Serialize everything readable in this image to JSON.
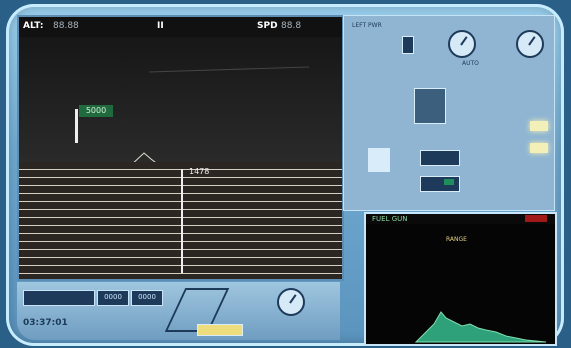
{
  "header": {
    "alt_label": "ALT:",
    "alt_value": "88.88",
    "spd_label": "SPD",
    "spd_value": "88.8",
    "pause_glyph": "II"
  },
  "map": {
    "flag_label": "5000",
    "marker_label": "1478"
  },
  "bottom_bar": {
    "readout_left": "03:37:01",
    "field_1": "0000",
    "field_2": "0000"
  },
  "right_panel": {
    "label_top": "LEFT PWR",
    "label_mid": "AUTO"
  },
  "scope": {
    "title": "FUEL GUN",
    "caption": "RANGE"
  },
  "colors": {
    "bezel": "#7fb8dc",
    "screen": "#111111",
    "flag": "#1f6b3d",
    "trace": "#2ea07a",
    "alert": "#a01818"
  }
}
